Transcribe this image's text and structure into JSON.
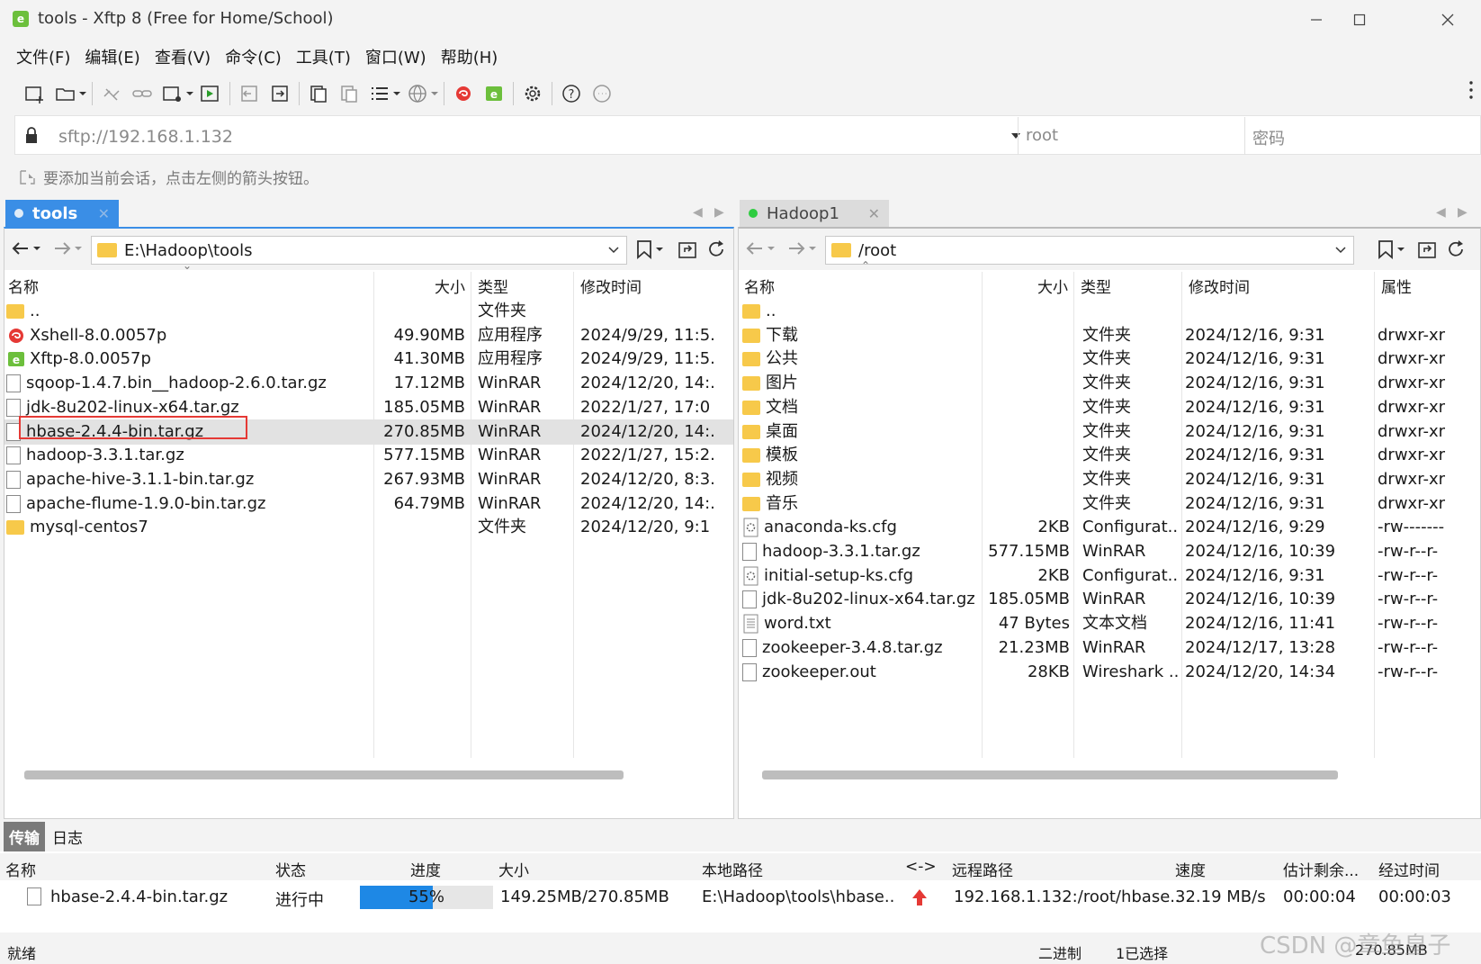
{
  "window": {
    "title": "tools - Xftp 8 (Free for Home/School)"
  },
  "menu": [
    "文件(F)",
    "编辑(E)",
    "查看(V)",
    "命令(C)",
    "工具(T)",
    "窗口(W)",
    "帮助(H)"
  ],
  "address": {
    "url": "sftp://192.168.1.132",
    "user_placeholder": "root",
    "password_placeholder": "密码"
  },
  "hint": "要添加当前会话，点击左侧的箭头按钮。",
  "left": {
    "tab": "tools",
    "path": "E:\\Hadoop\\tools",
    "columns": {
      "name": "名称",
      "size": "大小",
      "type": "类型",
      "mtime": "修改时间"
    },
    "rows": [
      {
        "name": "..",
        "size": "",
        "type": "文件夹",
        "mtime": "",
        "icon": "folder-icon"
      },
      {
        "name": "Xshell-8.0.0057p",
        "size": "49.90MB",
        "type": "应用程序",
        "mtime": "2024/9/29, 11:5.",
        "icon": "xshell-icon"
      },
      {
        "name": "Xftp-8.0.0057p",
        "size": "41.30MB",
        "type": "应用程序",
        "mtime": "2024/9/29, 11:5.",
        "icon": "xftp-icon"
      },
      {
        "name": "sqoop-1.4.7.bin__hadoop-2.6.0.tar.gz",
        "size": "17.12MB",
        "type": "WinRAR",
        "mtime": "2024/12/20, 14:.",
        "icon": "file-icon"
      },
      {
        "name": "jdk-8u202-linux-x64.tar.gz",
        "size": "185.05MB",
        "type": "WinRAR",
        "mtime": "2022/1/27, 17:0",
        "icon": "file-icon"
      },
      {
        "name": "hbase-2.4.4-bin.tar.gz",
        "size": "270.85MB",
        "type": "WinRAR",
        "mtime": "2024/12/20, 14:.",
        "icon": "file-icon"
      },
      {
        "name": "hadoop-3.3.1.tar.gz",
        "size": "577.15MB",
        "type": "WinRAR",
        "mtime": "2022/1/27, 15:2.",
        "icon": "file-icon"
      },
      {
        "name": "apache-hive-3.1.1-bin.tar.gz",
        "size": "267.93MB",
        "type": "WinRAR",
        "mtime": "2024/12/20, 8:3.",
        "icon": "file-icon"
      },
      {
        "name": "apache-flume-1.9.0-bin.tar.gz",
        "size": "64.79MB",
        "type": "WinRAR",
        "mtime": "2024/12/20, 14:.",
        "icon": "file-icon"
      },
      {
        "name": "mysql-centos7",
        "size": "",
        "type": "文件夹",
        "mtime": "2024/12/20, 9:1",
        "icon": "folder-icon"
      }
    ]
  },
  "right": {
    "tab": "Hadoop1",
    "path": "/root",
    "columns": {
      "name": "名称",
      "size": "大小",
      "type": "类型",
      "mtime": "修改时间",
      "attr": "属性"
    },
    "rows": [
      {
        "name": "..",
        "size": "",
        "type": "",
        "mtime": "",
        "attr": "",
        "icon": "folder-icon"
      },
      {
        "name": "下载",
        "size": "",
        "type": "文件夹",
        "mtime": "2024/12/16, 9:31",
        "attr": "drwxr-xr",
        "icon": "folder-icon"
      },
      {
        "name": "公共",
        "size": "",
        "type": "文件夹",
        "mtime": "2024/12/16, 9:31",
        "attr": "drwxr-xr",
        "icon": "folder-icon"
      },
      {
        "name": "图片",
        "size": "",
        "type": "文件夹",
        "mtime": "2024/12/16, 9:31",
        "attr": "drwxr-xr",
        "icon": "folder-icon"
      },
      {
        "name": "文档",
        "size": "",
        "type": "文件夹",
        "mtime": "2024/12/16, 9:31",
        "attr": "drwxr-xr",
        "icon": "folder-icon"
      },
      {
        "name": "桌面",
        "size": "",
        "type": "文件夹",
        "mtime": "2024/12/16, 9:31",
        "attr": "drwxr-xr",
        "icon": "folder-icon"
      },
      {
        "name": "模板",
        "size": "",
        "type": "文件夹",
        "mtime": "2024/12/16, 9:31",
        "attr": "drwxr-xr",
        "icon": "folder-icon"
      },
      {
        "name": "视频",
        "size": "",
        "type": "文件夹",
        "mtime": "2024/12/16, 9:31",
        "attr": "drwxr-xr",
        "icon": "folder-icon"
      },
      {
        "name": "音乐",
        "size": "",
        "type": "文件夹",
        "mtime": "2024/12/16, 9:31",
        "attr": "drwxr-xr",
        "icon": "folder-icon"
      },
      {
        "name": "anaconda-ks.cfg",
        "size": "2KB",
        "type": "Configurat...",
        "mtime": "2024/12/16, 9:29",
        "attr": "-rw-------",
        "icon": "config-icon"
      },
      {
        "name": "hadoop-3.3.1.tar.gz",
        "size": "577.15MB",
        "type": "WinRAR",
        "mtime": "2024/12/16, 10:39",
        "attr": "-rw-r--r-",
        "icon": "file-icon"
      },
      {
        "name": "initial-setup-ks.cfg",
        "size": "2KB",
        "type": "Configurat...",
        "mtime": "2024/12/16, 9:31",
        "attr": "-rw-r--r-",
        "icon": "config-icon"
      },
      {
        "name": "jdk-8u202-linux-x64.tar.gz",
        "size": "185.05MB",
        "type": "WinRAR",
        "mtime": "2024/12/16, 10:39",
        "attr": "-rw-r--r-",
        "icon": "file-icon"
      },
      {
        "name": "word.txt",
        "size": "47 Bytes",
        "type": "文本文档",
        "mtime": "2024/12/16, 11:41",
        "attr": "-rw-r--r-",
        "icon": "text-icon"
      },
      {
        "name": "zookeeper-3.4.8.tar.gz",
        "size": "21.23MB",
        "type": "WinRAR",
        "mtime": "2024/12/17, 13:28",
        "attr": "-rw-r--r-",
        "icon": "file-icon"
      },
      {
        "name": "zookeeper.out",
        "size": "28KB",
        "type": "Wireshark ...",
        "mtime": "2024/12/20, 14:34",
        "attr": "-rw-r--r-",
        "icon": "file-icon"
      }
    ]
  },
  "transfer": {
    "tabs": [
      "传输",
      "日志"
    ],
    "columns": [
      "名称",
      "状态",
      "进度",
      "大小",
      "本地路径",
      "<->",
      "远程路径",
      "速度",
      "估计剩余...",
      "经过时间"
    ],
    "row": {
      "name": "hbase-2.4.4-bin.tar.gz",
      "status": "进行中",
      "progress_label": "55%",
      "progress": 0.55,
      "size": "149.25MB/270.85MB",
      "local": "E:\\Hadoop\\tools\\hbase..",
      "remote": "192.168.1.132:/root/hbase..",
      "speed": "32.19 MB/s",
      "eta": "00:00:04",
      "elapsed": "00:00:03"
    }
  },
  "status": {
    "left": "就绪",
    "mode": "二进制",
    "selected": "1已选择",
    "size": "270.85MB"
  },
  "watermark": "CSDN @章鱼皇子",
  "colors": {
    "accent": "#3a8ee6",
    "progress": "#1e88e5",
    "highlight_box": "#e53935",
    "online_dot": "#2ecc40"
  }
}
